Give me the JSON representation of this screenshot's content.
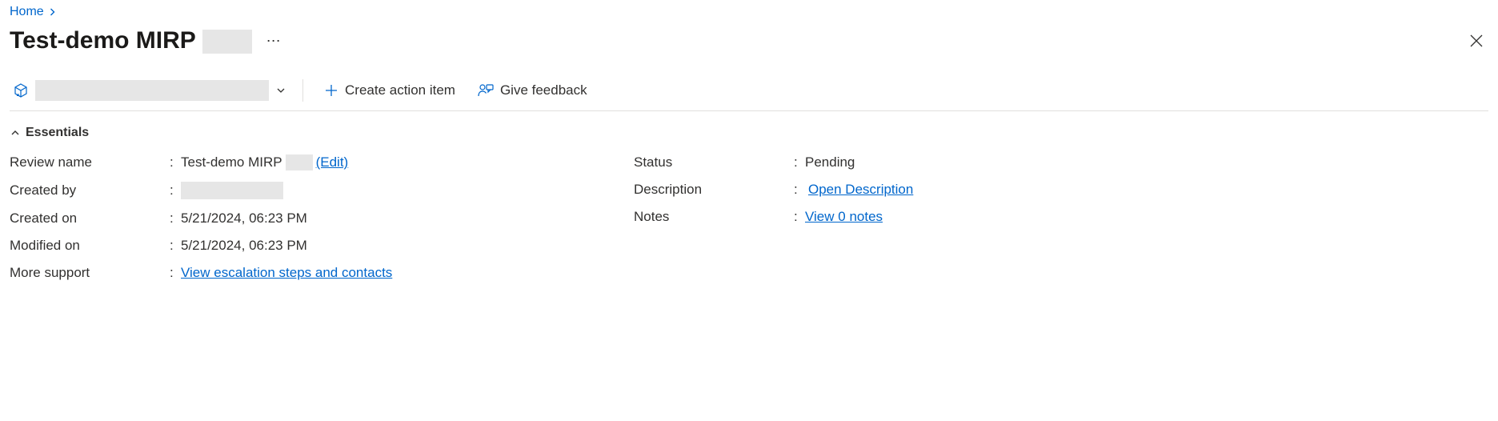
{
  "breadcrumb": {
    "home": "Home"
  },
  "title": "Test-demo MIRP",
  "toolbar": {
    "create_action_item": "Create action item",
    "give_feedback": "Give feedback"
  },
  "essentials": {
    "header": "Essentials",
    "left": [
      {
        "label": "Review name",
        "value": "Test-demo MIRP",
        "edit": "(Edit)",
        "has_redact_inline": true
      },
      {
        "label": "Created by",
        "value": "",
        "redacted": true
      },
      {
        "label": "Created on",
        "value": "5/21/2024, 06:23 PM"
      },
      {
        "label": "Modified on",
        "value": "5/21/2024, 06:23 PM"
      },
      {
        "label": "More support",
        "link": "View escalation steps and contacts"
      }
    ],
    "right": [
      {
        "label": "Status",
        "value": "Pending"
      },
      {
        "label": "Description",
        "link": "Open Description",
        "link_pad": true
      },
      {
        "label": "Notes",
        "link": "View 0 notes"
      }
    ]
  }
}
